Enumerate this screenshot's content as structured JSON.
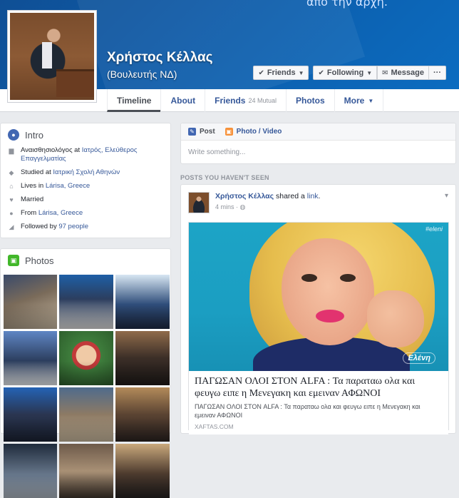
{
  "cover": {
    "top_text": "απο την αρχη.",
    "name": "Χρήστος Κέλλας",
    "subtitle": "(Βουλευτής ΝΔ)",
    "buttons": {
      "friends": "Friends",
      "following": "Following",
      "message": "Message",
      "more": "···"
    }
  },
  "tabs": [
    {
      "label": "Timeline"
    },
    {
      "label": "About"
    },
    {
      "label": "Friends",
      "badge": "24 Mutual"
    },
    {
      "label": "Photos"
    },
    {
      "label": "More"
    }
  ],
  "intro": {
    "title": "Intro",
    "items": [
      {
        "prefix": "Αναισθησιολόγος at ",
        "link": "Ιατρός, Ελεύθερος Επαγγελματίας",
        "icon": "briefcase-icon"
      },
      {
        "prefix": "Studied at ",
        "link": "Ιατρική Σχολή Αθηνών",
        "icon": "graduation-cap-icon"
      },
      {
        "prefix": "Lives in ",
        "link": "Lárisa, Greece",
        "icon": "home-icon"
      },
      {
        "prefix": "Married",
        "link": "",
        "icon": "heart-icon"
      },
      {
        "prefix": "From ",
        "link": "Lárisa, Greece",
        "icon": "location-pin-icon"
      },
      {
        "prefix": "Followed by ",
        "link": "97 people",
        "icon": "rss-icon"
      }
    ]
  },
  "photos": {
    "title": "Photos"
  },
  "composer": {
    "post_tab": "Post",
    "photo_tab": "Photo / Video",
    "placeholder": "Write something..."
  },
  "feed": {
    "section_label": "POSTS YOU HAVEN'T SEEN",
    "post": {
      "author": "Χρήστος Κέλλας",
      "action": " shared a ",
      "object": "link",
      "time": "4 mins",
      "link_title": "ΠΑΓΩΣΑΝ ΟΛΟΙ ΣΤΟΝ ALFA : Τα παραταω ολα και φευγω ειπε η Μενεγακη και εμειναν ΑΦΩΝΟΙ",
      "link_desc": "ΠΑΓΩΣΑΝ ΟΛΟΙ ΣΤΟΝ ALFA : Τα παραταω ολα και φευγω ειπε η Μενεγακη και εμειναν ΑΦΩΝΟΙ",
      "link_domain": "XAFTAS.COM",
      "image_tag": "#eleni",
      "image_logo": "Ελένη"
    }
  },
  "colors": {
    "link": "#365899",
    "cover_blue": "#0d5fae",
    "page_bg": "#e9ebee"
  }
}
